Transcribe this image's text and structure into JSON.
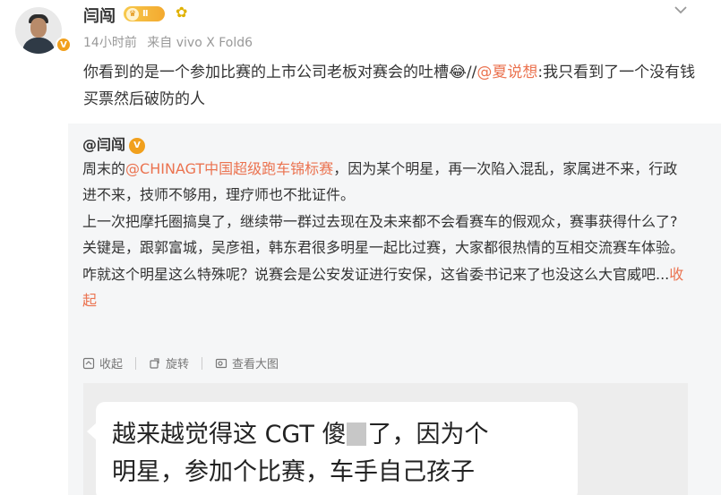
{
  "author": {
    "name": "闫闯",
    "level": "Ⅱ",
    "meta_time": "14小时前",
    "meta_source": "来自 vivo X Fold6"
  },
  "post": {
    "text_before": "你看到的是一个参加比赛的上市公司老板对赛会的吐槽",
    "emoji": "😂",
    "sep": "//",
    "mention": "@夏说想",
    "text_after": ":我只看到了一个没有钱买票然后破防的人"
  },
  "repost": {
    "author": "@闫闯",
    "p1_a": "周末的",
    "p1_link": "@CHINAGT中国超级跑车锦标赛",
    "p1_b": "，因为某个明星，再一次陷入混乱，家属进不来，行政进不来，技师不够用，理疗师也不批证件。",
    "p2": "上一次把摩托圈搞臭了，继续带一群过去现在及未来都不会看赛车的假观众，赛事获得什么了?",
    "p3": "关键是，跟郭富城，吴彦祖，韩东君很多明星一起比过赛，大家都很热情的互相交流赛车体验。咋就这个明星这么特殊呢？说赛会是公安发证进行安保，这省委书记来了也没这么大官威吧...",
    "collapse": "收起",
    "actions": {
      "collapse": "收起",
      "rotate": "旋转",
      "view_large": "查看大图"
    },
    "image_text_line1": "越来越觉得这 CGT 傻",
    "image_text_line1_b": "了，因为个",
    "image_text_line2": "明星，参加个比赛，车手自己孩子"
  },
  "colors": {
    "link": "#eb7350",
    "badge": "#f3a92f",
    "verified": "#f1a01d"
  },
  "icons": {
    "more": "chevron-down-icon",
    "verified": "verified-v-icon",
    "fan": "sunflower-icon"
  }
}
